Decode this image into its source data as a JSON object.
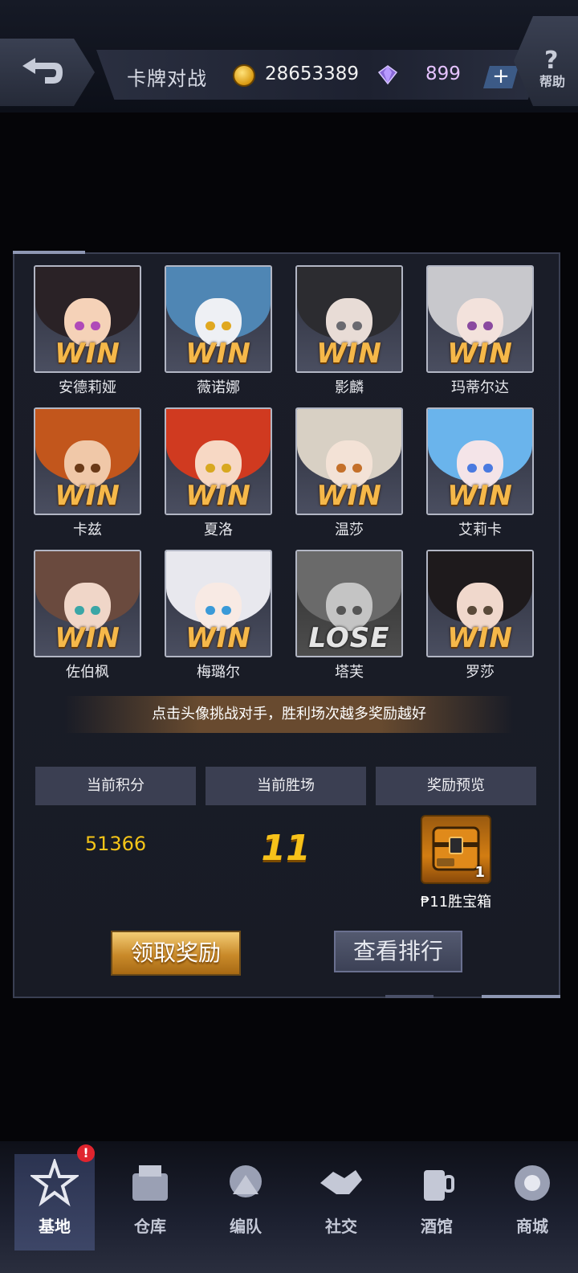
{
  "header": {
    "title": "卡牌对战",
    "coins": "28653389",
    "gems": "899",
    "plus_label": "+",
    "help_label": "帮助",
    "help_glyph": "?"
  },
  "opponents": [
    {
      "name": "安德莉娅",
      "result": "WIN",
      "hair": "#2a2226",
      "skin": "#f5d2b8",
      "eye": "#b04ab8"
    },
    {
      "name": "薇诺娜",
      "result": "WIN",
      "hair": "#4f86b4",
      "skin": "#eef0f4",
      "eye": "#e0a820"
    },
    {
      "name": "影麟",
      "result": "WIN",
      "hair": "#2c2c30",
      "skin": "#e8dcd6",
      "eye": "#6a6a70"
    },
    {
      "name": "玛蒂尔达",
      "result": "WIN",
      "hair": "#c8c8cc",
      "skin": "#f3e2dc",
      "eye": "#8a4aa0"
    },
    {
      "name": "卡兹",
      "result": "WIN",
      "hair": "#c2561c",
      "skin": "#f0c8a8",
      "eye": "#6a3a18"
    },
    {
      "name": "夏洛",
      "result": "WIN",
      "hair": "#d03a20",
      "skin": "#f7d8c4",
      "eye": "#d8a820"
    },
    {
      "name": "温莎",
      "result": "WIN",
      "hair": "#d8d0c4",
      "skin": "#f3e2d6",
      "eye": "#c4702a"
    },
    {
      "name": "艾莉卡",
      "result": "WIN",
      "hair": "#6ab4ec",
      "skin": "#f4e4e8",
      "eye": "#4a7ae0"
    },
    {
      "name": "佐伯枫",
      "result": "WIN",
      "hair": "#6a4a3e",
      "skin": "#f0d6c8",
      "eye": "#3aa6a6"
    },
    {
      "name": "梅璐尔",
      "result": "WIN",
      "hair": "#e8e8ee",
      "skin": "#f8eae4",
      "eye": "#3a9ad8"
    },
    {
      "name": "塔芙",
      "result": "LOSE",
      "hair": "#6a6a6a",
      "skin": "#c4c4c4",
      "eye": "#555555"
    },
    {
      "name": "罗莎",
      "result": "WIN",
      "hair": "#1e1a1c",
      "skin": "#f0d8cc",
      "eye": "#5a4a3a"
    }
  ],
  "hint": "点击头像挑战对手，胜利场次越多奖励越好",
  "stats": {
    "score_label": "当前积分",
    "wins_label": "当前胜场",
    "reward_label": "奖励预览",
    "score": "51366",
    "wins": "11",
    "reward_count": "1",
    "reward_name": "₱11胜宝箱"
  },
  "buttons": {
    "claim": "领取奖励",
    "ranking": "查看排行"
  },
  "nav": [
    {
      "label": "基地",
      "active": true
    },
    {
      "label": "仓库",
      "active": false
    },
    {
      "label": "编队",
      "active": false
    },
    {
      "label": "社交",
      "active": false
    },
    {
      "label": "酒馆",
      "active": false
    },
    {
      "label": "商城",
      "active": false
    }
  ],
  "nav_alert": "!",
  "colors": {
    "win": "#f5b84a",
    "lose": "#e4e4e4",
    "score": "#f5c518",
    "alert": "#e0242e"
  }
}
